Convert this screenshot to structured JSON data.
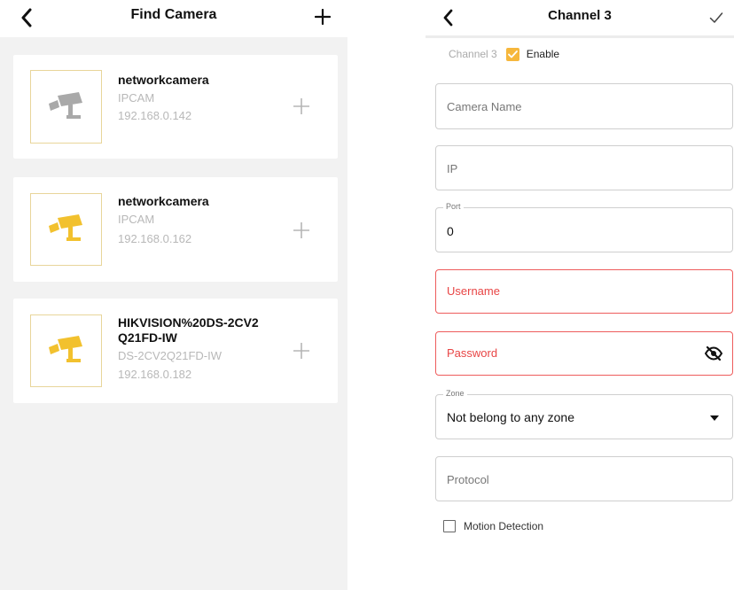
{
  "left_screen": {
    "title": "Find Camera",
    "icons": {
      "back": "chevron-left-icon",
      "add": "plus-icon"
    },
    "cameras": [
      {
        "name": "networkcamera",
        "model": "IPCAM",
        "ip": "192.168.0.142",
        "icon": "camera-icon",
        "icon_color": "#a9a9a9"
      },
      {
        "name": "networkcamera",
        "model": "IPCAM",
        "ip": "192.168.0.162",
        "icon": "camera-icon",
        "icon_color": "#f2c12e"
      },
      {
        "name": "HIKVISION%20DS-2CV2 Q21FD-IW",
        "model": "DS-2CV2Q21FD-IW",
        "ip": "192.168.0.182",
        "icon": "camera-icon",
        "icon_color": "#f2c12e"
      }
    ]
  },
  "right_screen": {
    "title": "Channel 3",
    "icons": {
      "back": "chevron-left-icon",
      "confirm": "checkmark-icon",
      "visibility": "eye-off-icon",
      "dropdown": "caret-down-icon"
    },
    "channel_label": "Channel 3",
    "enable": {
      "label": "Enable",
      "checked": true,
      "color": "#f6b73c"
    },
    "fields": {
      "camera_name": {
        "placeholder": "Camera Name",
        "value": ""
      },
      "ip": {
        "placeholder": "IP",
        "value": ""
      },
      "port": {
        "label": "Port",
        "value": "0"
      },
      "username": {
        "placeholder": "Username",
        "value": "",
        "error_color": "#e84545"
      },
      "password": {
        "placeholder": "Password",
        "value": "",
        "error_color": "#e84545"
      },
      "zone": {
        "label": "Zone",
        "value": "Not belong to any zone"
      },
      "protocol": {
        "placeholder": "Protocol",
        "value": ""
      }
    },
    "motion_detection": {
      "label": "Motion Detection",
      "checked": false
    }
  }
}
